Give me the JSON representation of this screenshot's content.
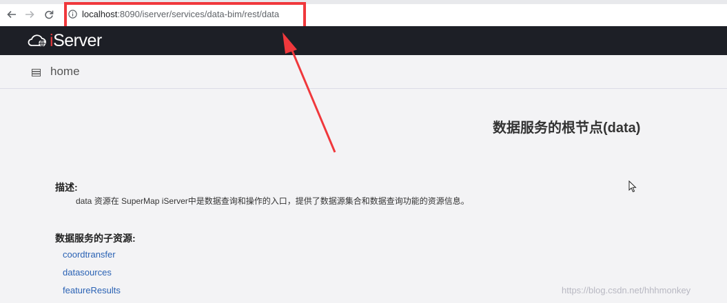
{
  "browser": {
    "url_host": "localhost",
    "url_rest": ":8090/iserver/services/data-bim/rest/data",
    "icons": {
      "back": "arrow-left-icon",
      "forward": "arrow-right-icon",
      "reload": "reload-icon",
      "info": "info-icon"
    }
  },
  "header": {
    "logo_i": "i",
    "logo_rest": "Server",
    "icon": "cloud-globe-icon"
  },
  "breadcrumb": {
    "home_label": "home",
    "icon": "list-icon"
  },
  "main": {
    "title": "数据服务的根节点(data)",
    "description_heading": "描述:",
    "description_text": "data 资源在 SuperMap iServer中是数据查询和操作的入口，提供了数据源集合和数据查询功能的资源信息。",
    "children_heading": "数据服务的子资源:",
    "children": [
      "coordtransfer",
      "datasources",
      "featureResults"
    ]
  },
  "watermark": "https://blog.csdn.net/hhhmonkey",
  "colors": {
    "highlight": "#f0383c",
    "header_bg": "#1d1f26",
    "link": "#2a62b4",
    "logo_accent": "#e5393c"
  }
}
